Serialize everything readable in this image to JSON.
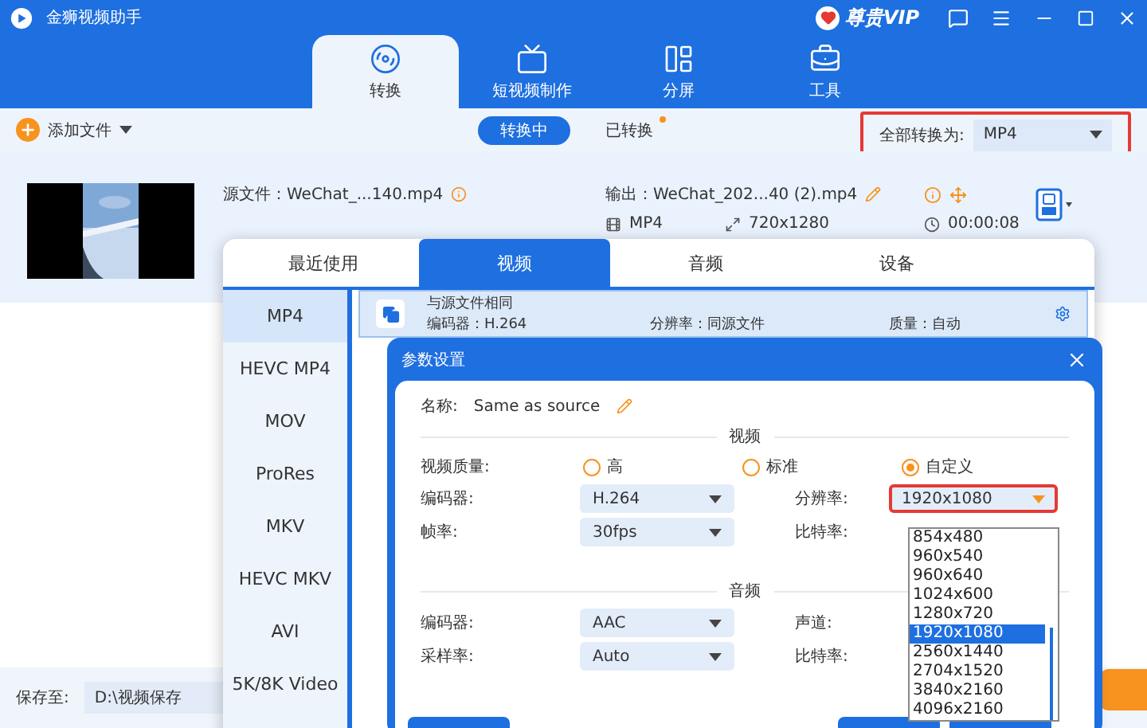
{
  "app": {
    "title": "金狮视频助手",
    "vip": "尊贵VIP"
  },
  "nav_tabs": [
    {
      "label": "转换",
      "kind": "convert",
      "selected": true
    },
    {
      "label": "短视频制作",
      "kind": "tv",
      "selected": false
    },
    {
      "label": "分屏",
      "kind": "split",
      "selected": false
    },
    {
      "label": "工具",
      "kind": "toolbox",
      "selected": false
    }
  ],
  "toolbar": {
    "add_file": "添加文件",
    "segments": [
      {
        "label": "转换中",
        "selected": true,
        "badge": false
      },
      {
        "label": "已转换",
        "selected": false,
        "badge": true
      }
    ],
    "convert_all_label": "全部转换为:",
    "convert_all_value": "MP4"
  },
  "file": {
    "source": "源文件：WeChat_...140.mp4",
    "output": "输出：WeChat_202...40 (2).mp4",
    "format": "MP4",
    "resolution": "720x1280",
    "duration": "00:00:08"
  },
  "save": {
    "label": "保存至:",
    "path": "D:\\视频保存"
  },
  "format_popup": {
    "tabs": [
      {
        "label": "最近使用",
        "selected": false
      },
      {
        "label": "视频",
        "selected": true
      },
      {
        "label": "音频",
        "selected": false
      },
      {
        "label": "设备",
        "selected": false
      }
    ],
    "formats": [
      {
        "label": "MP4",
        "selected": true
      },
      {
        "label": "HEVC MP4",
        "selected": false
      },
      {
        "label": "MOV",
        "selected": false
      },
      {
        "label": "ProRes",
        "selected": false
      },
      {
        "label": "MKV",
        "selected": false
      },
      {
        "label": "HEVC MKV",
        "selected": false
      },
      {
        "label": "AVI",
        "selected": false
      },
      {
        "label": "5K/8K Video",
        "selected": false
      }
    ],
    "preset": {
      "title": "与源文件相同",
      "encoder": "编码器：H.264",
      "resolution": "分辨率：同源文件",
      "quality": "质量：自动"
    }
  },
  "dialog": {
    "title": "参数设置",
    "name_label": "名称:",
    "name_value": "Same as source",
    "video_section": "视频",
    "quality_label": "视频质量:",
    "quality_options": [
      {
        "label": "高",
        "selected": false
      },
      {
        "label": "标准",
        "selected": false
      },
      {
        "label": "自定义",
        "selected": true
      }
    ],
    "video_fields": [
      {
        "label": "编码器:",
        "value": "H.264",
        "highlighted": false
      },
      {
        "label": "分辨率:",
        "value": "1920x1080",
        "highlighted": true
      },
      {
        "label": "帧率:",
        "value": "30fps",
        "highlighted": false
      },
      {
        "label": "比特率:"
      }
    ],
    "audio_section": "音频",
    "audio_fields": [
      {
        "label": "编码器:",
        "value": "AAC",
        "highlighted": false
      },
      {
        "label": "声道:"
      },
      {
        "label": "采样率:",
        "value": "Auto",
        "highlighted": false
      },
      {
        "label": "比特率:"
      }
    ],
    "resolution_options": [
      {
        "label": "854x480",
        "selected": false
      },
      {
        "label": "960x540",
        "selected": false
      },
      {
        "label": "960x640",
        "selected": false
      },
      {
        "label": "1024x600",
        "selected": false
      },
      {
        "label": "1280x720",
        "selected": false
      },
      {
        "label": "1920x1080",
        "selected": true
      },
      {
        "label": "2560x1440",
        "selected": false
      },
      {
        "label": "2704x1520",
        "selected": false
      },
      {
        "label": "3840x2160",
        "selected": false
      },
      {
        "label": "4096x2160",
        "selected": false
      }
    ]
  }
}
